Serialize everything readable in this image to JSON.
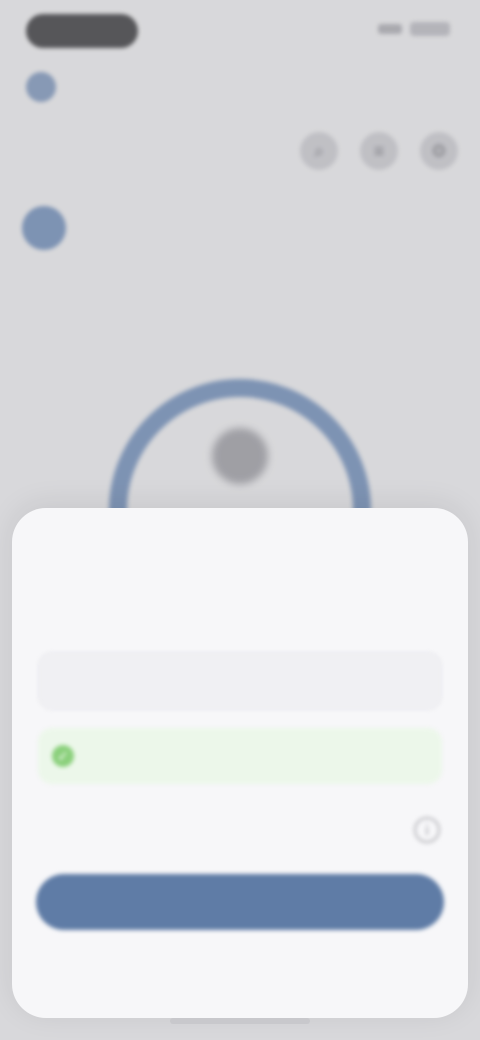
{
  "status_bar": {
    "time": "",
    "signal_icon": "signal-icon",
    "battery_icon": "battery-icon"
  },
  "profile": {
    "name": "",
    "action": ""
  },
  "header": {
    "title": "",
    "icons": [
      "search-icon",
      "filter-icon",
      "settings-icon"
    ]
  },
  "week": [
    {
      "day": "",
      "num": "",
      "active": true
    },
    {
      "day": "",
      "num": ""
    },
    {
      "day": "",
      "num": ""
    },
    {
      "day": "",
      "num": ""
    },
    {
      "day": "",
      "num": ""
    },
    {
      "day": "",
      "num": ""
    },
    {
      "day": "",
      "num": ""
    }
  ],
  "summary": {
    "label": ""
  },
  "ring": {
    "color": "#5f7ca6",
    "track_color": "#c9c9ce"
  },
  "sheet": {
    "title": "",
    "field_label": "",
    "input_value": "",
    "success_message": "",
    "toggle_label": "",
    "button_label": ""
  },
  "colors": {
    "accent": "#5f7ca6",
    "success": "#8bd07c",
    "success_bg": "#ecf7ea"
  }
}
